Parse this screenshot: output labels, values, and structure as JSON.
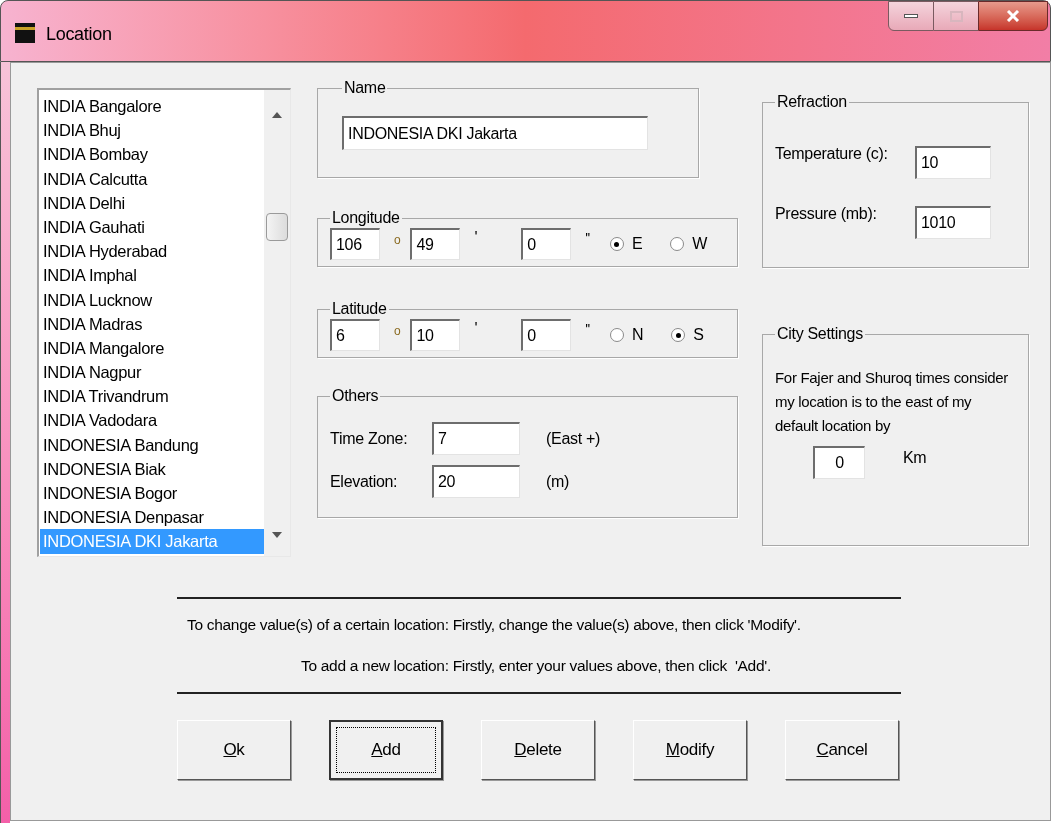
{
  "window": {
    "title": "Location"
  },
  "locations": [
    {
      "name": "INDIA Bangalore",
      "selected": false
    },
    {
      "name": "INDIA Bhuj",
      "selected": false
    },
    {
      "name": "INDIA Bombay",
      "selected": false
    },
    {
      "name": "INDIA Calcutta",
      "selected": false
    },
    {
      "name": "INDIA Delhi",
      "selected": false
    },
    {
      "name": "INDIA Gauhati",
      "selected": false
    },
    {
      "name": "INDIA Hyderabad",
      "selected": false
    },
    {
      "name": "INDIA Imphal",
      "selected": false
    },
    {
      "name": "INDIA Lucknow",
      "selected": false
    },
    {
      "name": "INDIA Madras",
      "selected": false
    },
    {
      "name": "INDIA Mangalore",
      "selected": false
    },
    {
      "name": "INDIA Nagpur",
      "selected": false
    },
    {
      "name": "INDIA Trivandrum",
      "selected": false
    },
    {
      "name": "INDIA Vadodara",
      "selected": false
    },
    {
      "name": "INDONESIA Bandung",
      "selected": false
    },
    {
      "name": "INDONESIA Biak",
      "selected": false
    },
    {
      "name": "INDONESIA Bogor",
      "selected": false
    },
    {
      "name": "INDONESIA Denpasar",
      "selected": false
    },
    {
      "name": "INDONESIA DKI Jakarta",
      "selected": true
    }
  ],
  "name_group": {
    "title": "Name",
    "value": "INDONESIA DKI Jakarta"
  },
  "longitude": {
    "title": "Longitude",
    "degrees": "106",
    "degree_sign": "o",
    "minutes": "49",
    "minute_sign": "'",
    "seconds": "0",
    "second_sign": "''",
    "options": [
      {
        "label": "E",
        "selected": true
      },
      {
        "label": "W",
        "selected": false
      }
    ]
  },
  "latitude": {
    "title": "Latitude",
    "degrees": "6",
    "degree_sign": "o",
    "minutes": "10",
    "minute_sign": "'",
    "seconds": "0",
    "second_sign": "''",
    "options": [
      {
        "label": "N",
        "selected": false
      },
      {
        "label": "S",
        "selected": true
      }
    ]
  },
  "others": {
    "title": "Others",
    "fields": [
      {
        "label": "Time Zone:",
        "value": "7",
        "unit": "(East +)"
      },
      {
        "label": "Elevation:",
        "value": "20",
        "unit": "(m)"
      }
    ]
  },
  "refraction": {
    "title": "Refraction",
    "fields": [
      {
        "label": "Temperature (c):",
        "value": "10"
      },
      {
        "label": "Pressure (mb):",
        "value": "1010"
      }
    ]
  },
  "city_settings": {
    "title": "City Settings",
    "description": "For Fajer and Shuroq times consider my location is to the east of my default location by",
    "value": "0",
    "unit": "Km"
  },
  "instructions": [
    "To change value(s) of a certain location: Firstly, change the value(s) above, then click 'Modify'.",
    "To add a new location: Firstly, enter your values above, then click  'Add'."
  ],
  "buttons": [
    {
      "label": "Ok",
      "focused": false
    },
    {
      "label": "Add",
      "focused": true
    },
    {
      "label": "Delete",
      "focused": false
    },
    {
      "label": "Modify",
      "focused": false
    },
    {
      "label": "Cancel",
      "focused": false
    }
  ]
}
